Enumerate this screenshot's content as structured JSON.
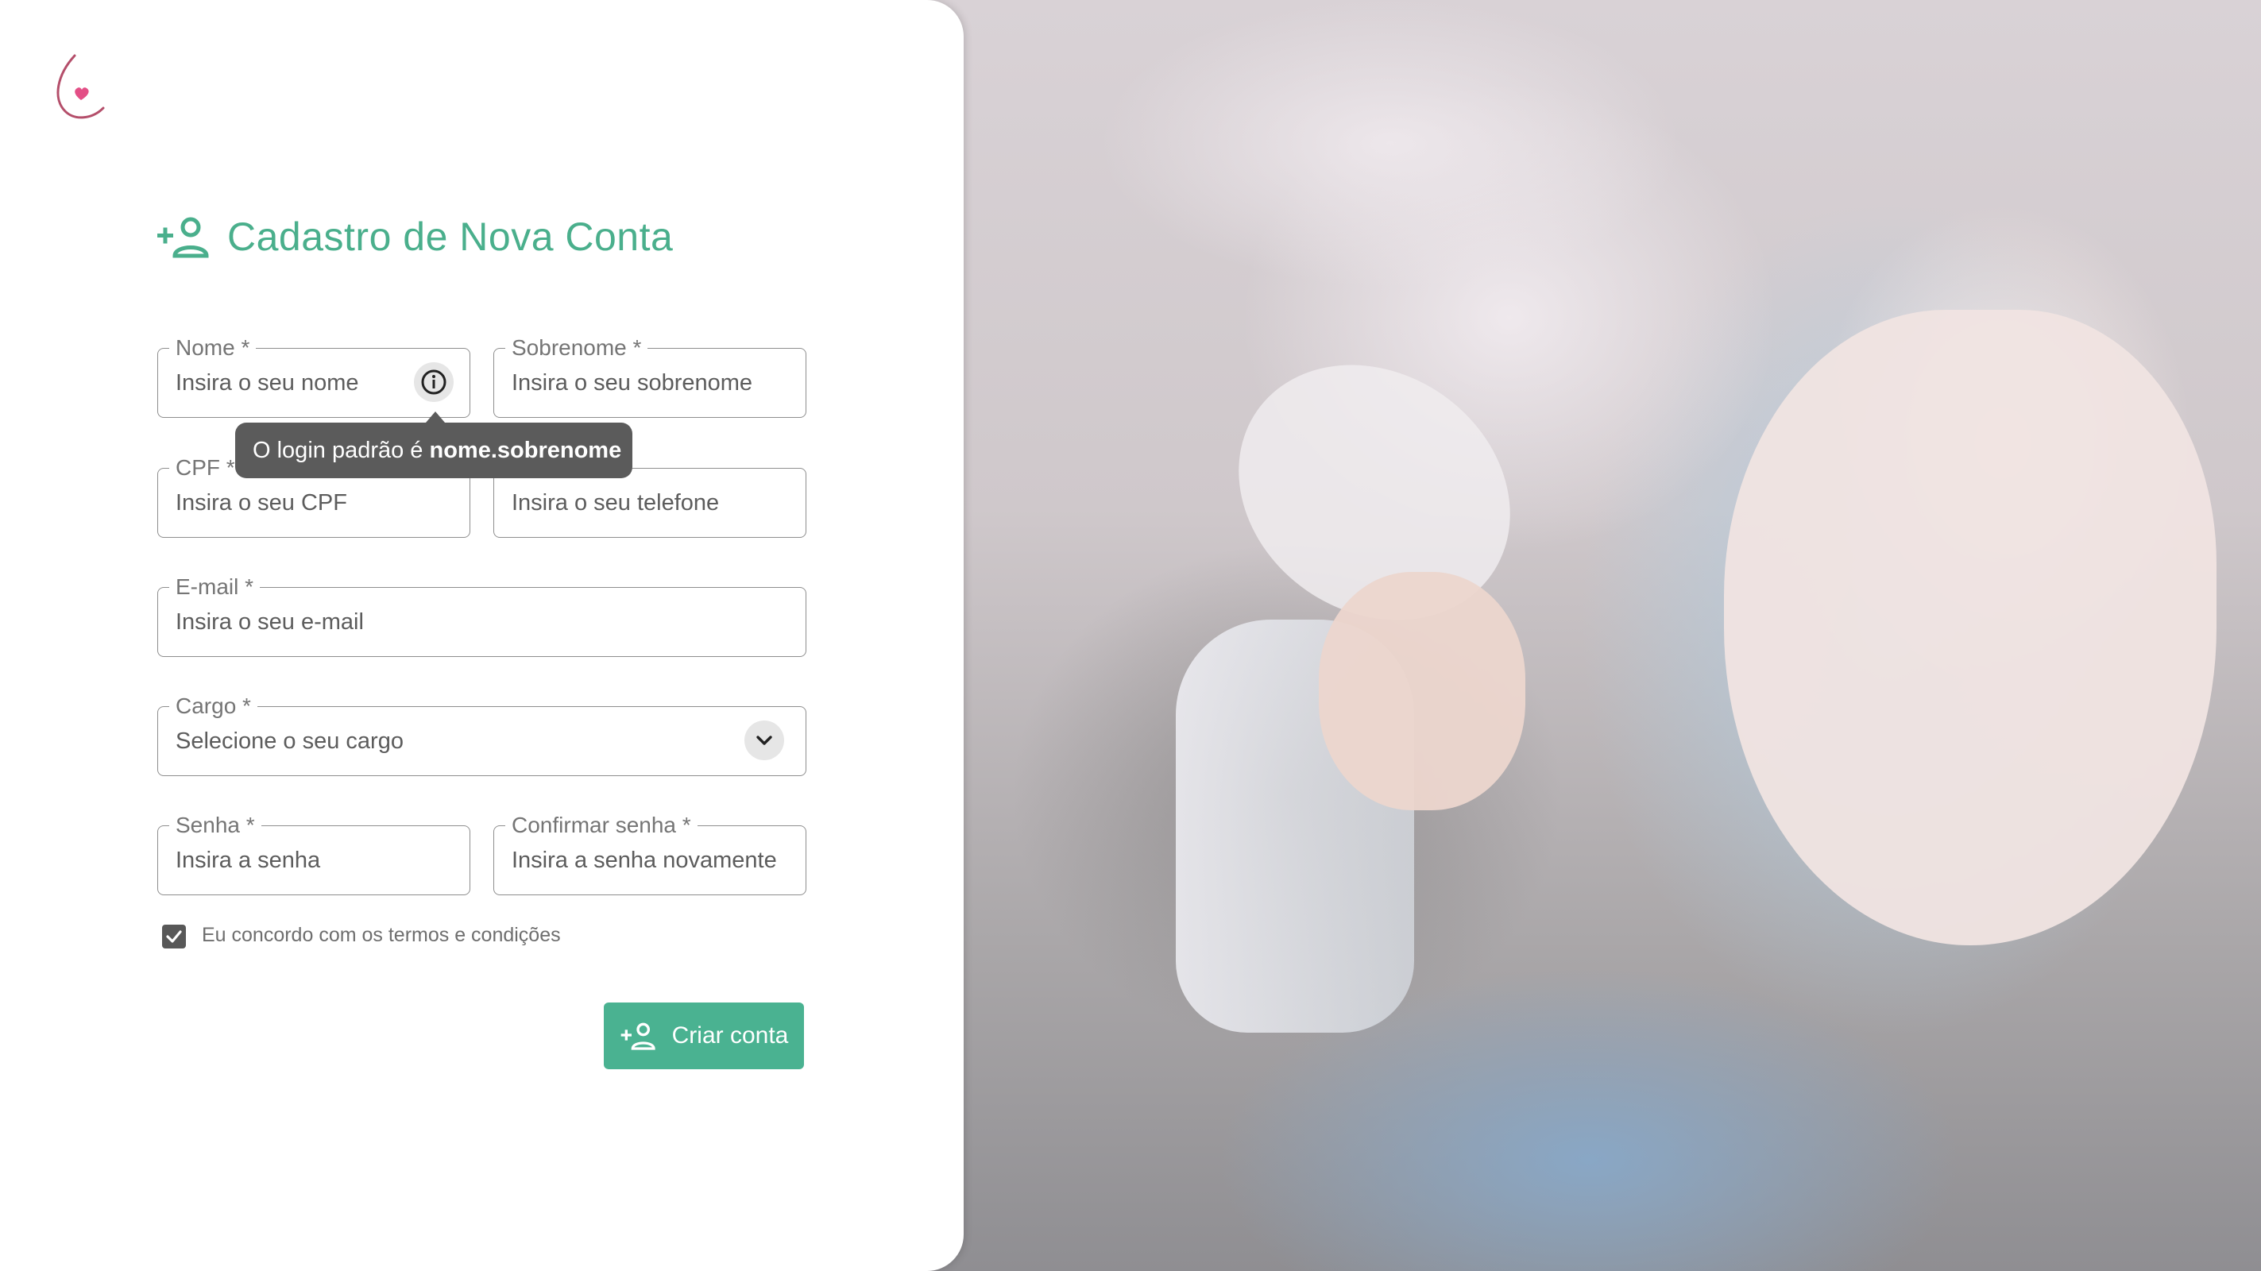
{
  "form": {
    "title": "Cadastro de Nova Conta",
    "fields": {
      "nome": {
        "label": "Nome *",
        "placeholder": "Insira o seu nome"
      },
      "sobrenome": {
        "label": "Sobrenome *",
        "placeholder": "Insira o seu sobrenome"
      },
      "cpf": {
        "label": "CPF *",
        "placeholder": "Insira o seu CPF"
      },
      "telefone": {
        "label": "",
        "placeholder": "Insira o seu telefone"
      },
      "email": {
        "label": "E-mail *",
        "placeholder": "Insira o seu e-mail"
      },
      "cargo": {
        "label": "Cargo *",
        "placeholder": "Selecione o seu cargo"
      },
      "senha": {
        "label": "Senha *",
        "placeholder": "Insira a senha"
      },
      "confirmar": {
        "label": "Confirmar senha *",
        "placeholder": "Insira a senha novamente"
      }
    },
    "tooltip": {
      "prefix": "O login padrão é ",
      "bold": "nome.sobrenome"
    },
    "terms": {
      "label": "Eu concordo com os termos e condições",
      "checked": true
    },
    "submit_label": "Criar conta"
  },
  "icons": {
    "logo": "drop-heart-logo",
    "title": "person-add-icon",
    "info": "info-icon",
    "dropdown": "chevron-down-icon",
    "submit": "person-add-icon"
  },
  "colors": {
    "accent": "#4ab291",
    "title": "#4aaf8c",
    "logo_heart": "#e34f86",
    "logo_stroke": "#b44e6a"
  }
}
